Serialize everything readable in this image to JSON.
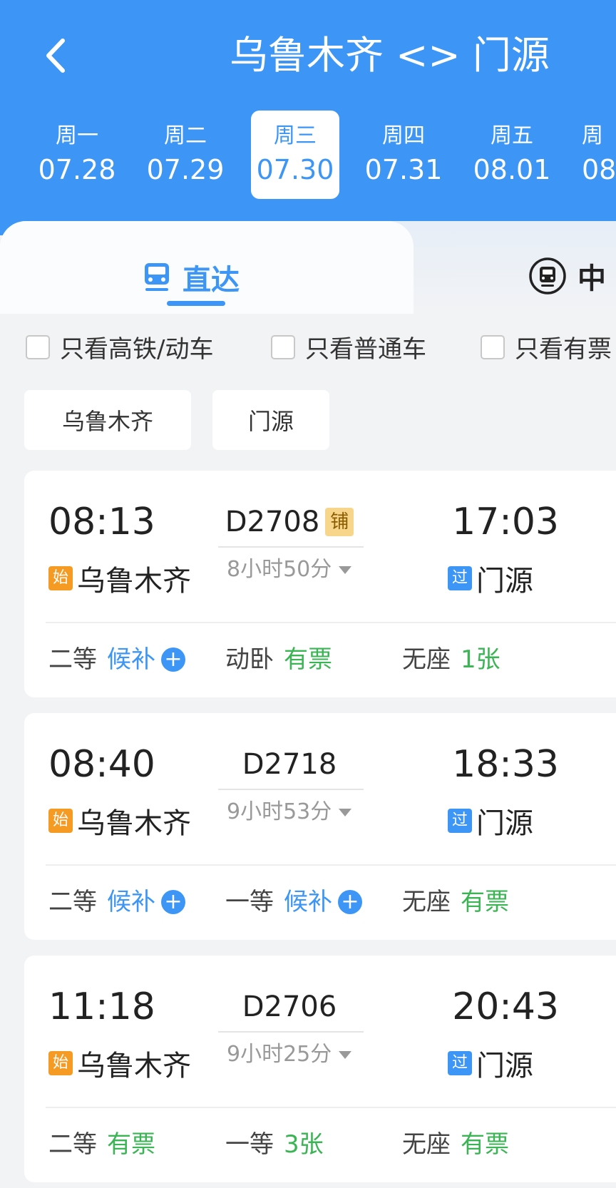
{
  "header": {
    "title": "乌鲁木齐 <> 门源",
    "back_icon": "chevron-left-icon",
    "days": [
      {
        "weekday": "周一",
        "date": "07.28",
        "active": false
      },
      {
        "weekday": "周二",
        "date": "07.29",
        "active": false
      },
      {
        "weekday": "周三",
        "date": "07.30",
        "active": true
      },
      {
        "weekday": "周四",
        "date": "07.31",
        "active": false
      },
      {
        "weekday": "周五",
        "date": "08.01",
        "active": false
      },
      {
        "weekday": "周",
        "date": "08",
        "active": false
      }
    ]
  },
  "tabs": {
    "direct_label": "直达",
    "transfer_label": "中"
  },
  "filters": {
    "high_speed": "只看高铁/动车",
    "normal": "只看普通车",
    "available": "只看有票"
  },
  "stations": {
    "from": "乌鲁木齐",
    "to": "门源"
  },
  "trains": [
    {
      "dep_time": "08:13",
      "arr_time": "17:03",
      "train_no": "D2708",
      "bunk_badge": "铺",
      "duration": "8小时50分",
      "dep_station": "乌鲁木齐",
      "dep_tag": "始",
      "arr_station": "门源",
      "arr_tag": "过",
      "seats": [
        {
          "class": "二等",
          "status": "候补",
          "type": "waitlist"
        },
        {
          "class": "动卧",
          "status": "有票",
          "type": "available"
        },
        {
          "class": "无座",
          "status": "1张",
          "type": "available"
        }
      ]
    },
    {
      "dep_time": "08:40",
      "arr_time": "18:33",
      "train_no": "D2718",
      "bunk_badge": "",
      "duration": "9小时53分",
      "dep_station": "乌鲁木齐",
      "dep_tag": "始",
      "arr_station": "门源",
      "arr_tag": "过",
      "seats": [
        {
          "class": "二等",
          "status": "候补",
          "type": "waitlist"
        },
        {
          "class": "一等",
          "status": "候补",
          "type": "waitlist"
        },
        {
          "class": "无座",
          "status": "有票",
          "type": "available"
        }
      ]
    },
    {
      "dep_time": "11:18",
      "arr_time": "20:43",
      "train_no": "D2706",
      "bunk_badge": "",
      "duration": "9小时25分",
      "dep_station": "乌鲁木齐",
      "dep_tag": "始",
      "arr_station": "门源",
      "arr_tag": "过",
      "seats": [
        {
          "class": "二等",
          "status": "有票",
          "type": "available"
        },
        {
          "class": "一等",
          "status": "3张",
          "type": "available"
        },
        {
          "class": "无座",
          "status": "有票",
          "type": "available"
        }
      ]
    }
  ],
  "colors": {
    "primary": "#3d96f5",
    "available": "#3bb454",
    "start_tag": "#f59a23"
  }
}
